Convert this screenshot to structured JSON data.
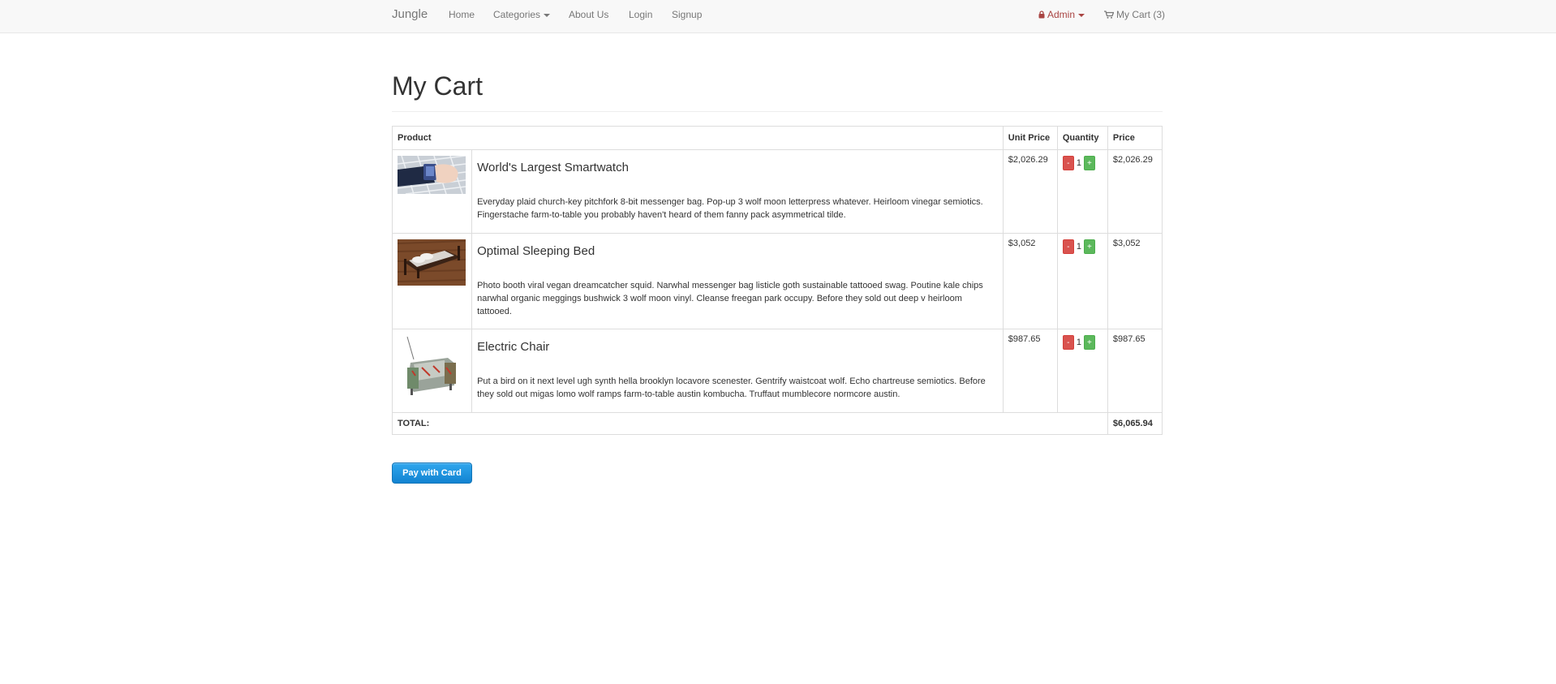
{
  "nav": {
    "brand": "Jungle",
    "links": [
      "Home",
      "Categories",
      "About Us",
      "Login",
      "Signup"
    ],
    "admin_label": "Admin",
    "cart_label": "My Cart (3)",
    "admin_color": "#a94442"
  },
  "page": {
    "title": "My Cart"
  },
  "table": {
    "headers": {
      "product": "Product",
      "unit_price": "Unit Price",
      "quantity": "Quantity",
      "price": "Price"
    },
    "rows": [
      {
        "name": "World's Largest Smartwatch",
        "description": "Everyday plaid church-key pitchfork 8-bit messenger bag. Pop-up 3 wolf moon letterpress whatever. Heirloom vinegar semiotics. Fingerstache farm-to-table you probably haven't heard of them fanny pack asymmetrical tilde.",
        "unit_price": "$2,026.29",
        "quantity": "1",
        "price": "$2,026.29",
        "image": "smartwatch-photo"
      },
      {
        "name": "Optimal Sleeping Bed",
        "description": "Photo booth viral vegan dreamcatcher squid. Narwhal messenger bag listicle goth sustainable tattooed swag. Poutine kale chips narwhal organic meggings bushwick 3 wolf moon vinyl. Cleanse freegan park occupy. Before they sold out deep v heirloom tattooed.",
        "unit_price": "$3,052",
        "quantity": "1",
        "price": "$3,052",
        "image": "bed-photo"
      },
      {
        "name": "Electric Chair",
        "description": "Put a bird on it next level ugh synth hella brooklyn locavore scenester. Gentrify waistcoat wolf. Echo chartreuse semiotics. Before they sold out migas lomo wolf ramps farm-to-table austin kombucha. Truffaut mumblecore normcore austin.",
        "unit_price": "$987.65",
        "quantity": "1",
        "price": "$987.65",
        "image": "chair-photo"
      }
    ],
    "minus_label": "-",
    "plus_label": "+",
    "total_label": "TOTAL:",
    "total_value": "$6,065.94"
  },
  "pay_button_label": "Pay with Card"
}
